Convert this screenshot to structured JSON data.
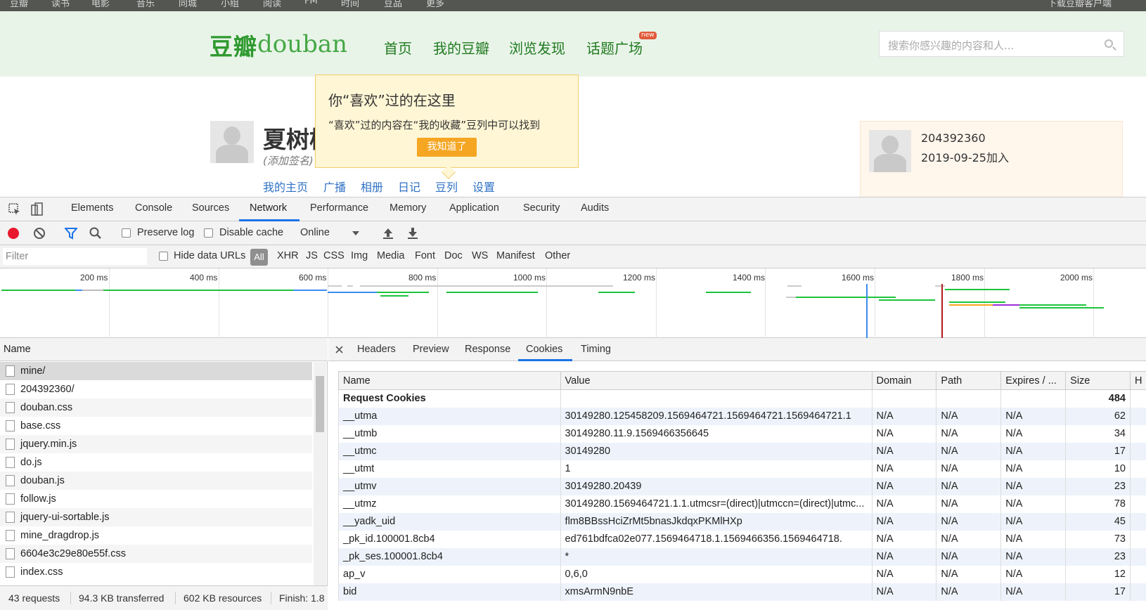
{
  "site": {
    "topnav": [
      "豆瓣",
      "读书",
      "电影",
      "音乐",
      "同城",
      "小组",
      "阅读",
      "FM",
      "时间",
      "豆品",
      "更多"
    ],
    "topnav_right": "下载豆瓣客户端",
    "logo_cn": "豆瓣",
    "logo_en": "douban",
    "mainnav": [
      "首页",
      "我的豆瓣",
      "浏览发现",
      "话题广场"
    ],
    "new_badge": "new",
    "search_placeholder": "搜索你感兴趣的内容和人...",
    "profile_name": "夏树柏",
    "profile_sign": "(添加签名)",
    "profile_nav": [
      "我的主页",
      "广播",
      "相册",
      "日记",
      "豆列",
      "设置"
    ],
    "tooltip": {
      "title": "你“喜欢”过的在这里",
      "body": "“喜欢”过的内容在“我的收藏”豆列中可以找到",
      "button": "我知道了"
    },
    "card": {
      "id": "204392360",
      "joined": "2019-09-25加入"
    }
  },
  "devtools": {
    "tabs": [
      "Elements",
      "Console",
      "Sources",
      "Network",
      "Performance",
      "Memory",
      "Application",
      "Security",
      "Audits"
    ],
    "active_tab": "Network",
    "toolbar": {
      "preserve_log": "Preserve log",
      "disable_cache": "Disable cache",
      "throttle": "Online"
    },
    "filter": {
      "placeholder": "Filter",
      "hide_data_urls": "Hide data URLs",
      "types": [
        "All",
        "XHR",
        "JS",
        "CSS",
        "Img",
        "Media",
        "Font",
        "Doc",
        "WS",
        "Manifest",
        "Other"
      ]
    },
    "timeline_ticks": [
      "200 ms",
      "400 ms",
      "600 ms",
      "800 ms",
      "1000 ms",
      "1200 ms",
      "1400 ms",
      "1600 ms",
      "1800 ms",
      "2000 ms"
    ],
    "name_header": "Name",
    "requests": [
      "mine/",
      "204392360/",
      "douban.css",
      "base.css",
      "jquery.min.js",
      "do.js",
      "douban.js",
      "follow.js",
      "jquery-ui-sortable.js",
      "mine_dragdrop.js",
      "6604e3c29e80e55f.css",
      "index.css"
    ],
    "status": {
      "requests": "43 requests",
      "transferred": "94.3 KB transferred",
      "resources": "602 KB resources",
      "finish": "Finish: 1.8"
    },
    "detail_tabs": [
      "Headers",
      "Preview",
      "Response",
      "Cookies",
      "Timing"
    ],
    "active_detail_tab": "Cookies",
    "cookie_columns": [
      "Name",
      "Value",
      "Domain",
      "Path",
      "Expires / ...",
      "Size",
      "H"
    ],
    "request_cookies_label": "Request Cookies",
    "request_cookies_size": "484",
    "cookies": [
      {
        "name": "__utma",
        "value": "30149280.125458209.1569464721.1569464721.1569464721.1",
        "domain": "N/A",
        "path": "N/A",
        "expires": "N/A",
        "size": "62"
      },
      {
        "name": "__utmb",
        "value": "30149280.11.9.1569466356645",
        "domain": "N/A",
        "path": "N/A",
        "expires": "N/A",
        "size": "34"
      },
      {
        "name": "__utmc",
        "value": "30149280",
        "domain": "N/A",
        "path": "N/A",
        "expires": "N/A",
        "size": "17"
      },
      {
        "name": "__utmt",
        "value": "1",
        "domain": "N/A",
        "path": "N/A",
        "expires": "N/A",
        "size": "10"
      },
      {
        "name": "__utmv",
        "value": "30149280.20439",
        "domain": "N/A",
        "path": "N/A",
        "expires": "N/A",
        "size": "23"
      },
      {
        "name": "__utmz",
        "value": "30149280.1569464721.1.1.utmcsr=(direct)|utmccn=(direct)|utmc...",
        "domain": "N/A",
        "path": "N/A",
        "expires": "N/A",
        "size": "78"
      },
      {
        "name": "__yadk_uid",
        "value": "flm8BBssHciZrMt5bnasJkdqxPKMlHXp",
        "domain": "N/A",
        "path": "N/A",
        "expires": "N/A",
        "size": "45"
      },
      {
        "name": "_pk_id.100001.8cb4",
        "value": "ed761bdfca02e077.1569464718.1.1569466356.1569464718.",
        "domain": "N/A",
        "path": "N/A",
        "expires": "N/A",
        "size": "73"
      },
      {
        "name": "_pk_ses.100001.8cb4",
        "value": "*",
        "domain": "N/A",
        "path": "N/A",
        "expires": "N/A",
        "size": "23"
      },
      {
        "name": "ap_v",
        "value": "0,6,0",
        "domain": "N/A",
        "path": "N/A",
        "expires": "N/A",
        "size": "12"
      },
      {
        "name": "bid",
        "value": "xmsArmN9nbE",
        "domain": "N/A",
        "path": "N/A",
        "expires": "N/A",
        "size": "17"
      }
    ],
    "colors": {
      "accent": "#1a73e8",
      "record": "#e8192c",
      "green_bar": "#1dc43a",
      "blue_bar": "#3b8cf2"
    }
  }
}
